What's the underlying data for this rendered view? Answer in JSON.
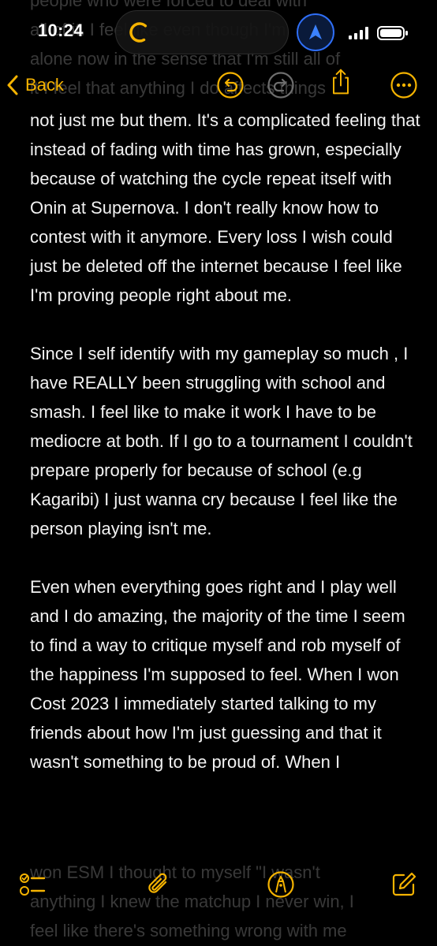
{
  "status_bar": {
    "time": "10:24"
  },
  "nav": {
    "back_label": "Back"
  },
  "note": {
    "paragraphs": [
      "not just me but them. It's a complicated feeling that instead of fading with time has grown, especially because of watching the cycle repeat itself with Onin at Supernova. I don't really know how to contest with it anymore. Every loss I wish could just be deleted off the internet because I feel like I'm proving people right about me.",
      "Since I self identify with my gameplay so much , I have REALLY been struggling with school and smash. I feel like to make it work I have to be mediocre at both. If I go to a tournament I couldn't prepare properly for because of school (e.g Kagaribi) I just wanna cry because I feel like the person playing isn't me.",
      "Even when everything goes right and I play well and I do amazing, the majority of the time I seem to find a way to critique myself and rob myself of the happiness I'm supposed to feel. When I won Cost 2023 I immediately started talking to my friends about how I'm just guessing and that it wasn't something to be proud of. When I"
    ],
    "faded_lines": {
      "top": [
        "people who were forced to deal with",
        "all of it. I feel like even though I'm",
        "alone now in the sense that I'm still all of",
        "it I feel that anything I do affects things"
      ],
      "bottom": [
        "won ESM I thought to myself \"I wasn't",
        "anything I knew the matchup I never win, I",
        "feel like there's something wrong with me"
      ]
    }
  },
  "colors": {
    "accent": "#f5b301",
    "background": "#000000",
    "location_blue": "#2f6ff7"
  },
  "icons": {
    "undo": "undo-icon",
    "redo": "redo-icon",
    "share": "share-icon",
    "more": "more-icon",
    "checklist": "checklist-icon",
    "attach": "paperclip-icon",
    "markup": "markup-pen-icon",
    "compose": "compose-icon"
  }
}
